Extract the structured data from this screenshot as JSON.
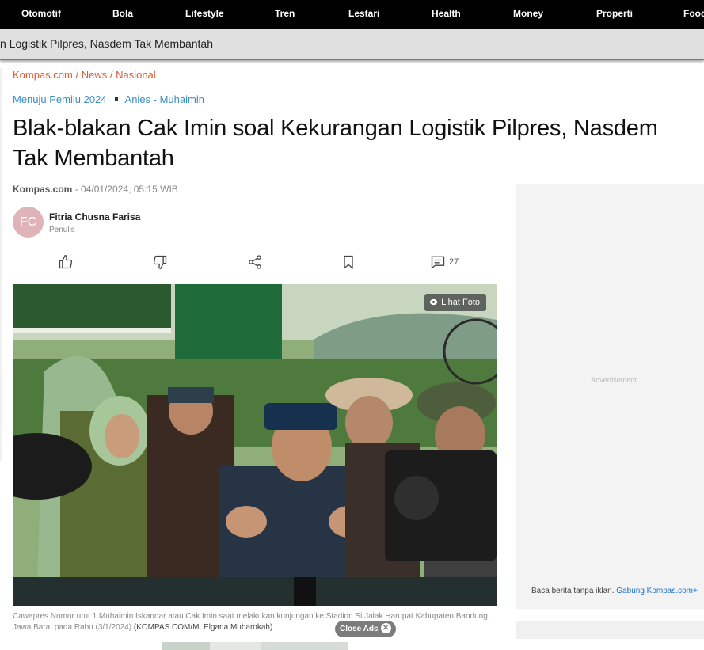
{
  "nav": {
    "items": [
      "Otomotif",
      "Bola",
      "Lifestyle",
      "Tren",
      "Lestari",
      "Health",
      "Money",
      "Properti",
      "Food"
    ]
  },
  "sticky": {
    "title": "n Logistik Pilpres, Nasdem Tak Membantah"
  },
  "breadcrumb": {
    "site": "Kompas.com",
    "sep": " / ",
    "section": "News",
    "subsection": "Nasional"
  },
  "tags": [
    "Menuju Pemilu 2024",
    "Anies - Muhaimin"
  ],
  "article": {
    "headline": "Blak-blakan Cak Imin soal Kekurangan Logistik Pilpres, Nasdem Tak Membantah",
    "source": "Kompas.com",
    "date": " - 04/01/2024, 05:15 WIB",
    "author_initials": "FC",
    "author_name": "Fitria Chusna Farisa",
    "author_role": "Penulis",
    "comment_count": "27"
  },
  "photo": {
    "button_label": "Lihat Foto",
    "caption": "Cawapres Nomor urut 1 Muhaimin Iskandar atau Cak Imin saat melakukan kunjungan ke Stadion Si Jalak Harupat Kabupaten Bandung, Jawa Barat pada Rabu (3/1/2024)",
    "credit": "(KOMPAS.COM/M. Elgana Mubarokah)",
    "close_ads": "Close Ads"
  },
  "ad": {
    "label": "Advertisement",
    "footer_text": "Baca berita tanpa iklan. ",
    "footer_link": "Gabung Kompas.com+"
  },
  "colors": {
    "nav_bg": "#000000",
    "breadcrumb": "#e35a2e",
    "tag": "#3c8dbc",
    "link": "#1e6fd0"
  },
  "icons": [
    "like-icon",
    "dislike-icon",
    "share-icon",
    "bookmark-icon",
    "comment-icon",
    "eye-icon",
    "close-icon"
  ]
}
